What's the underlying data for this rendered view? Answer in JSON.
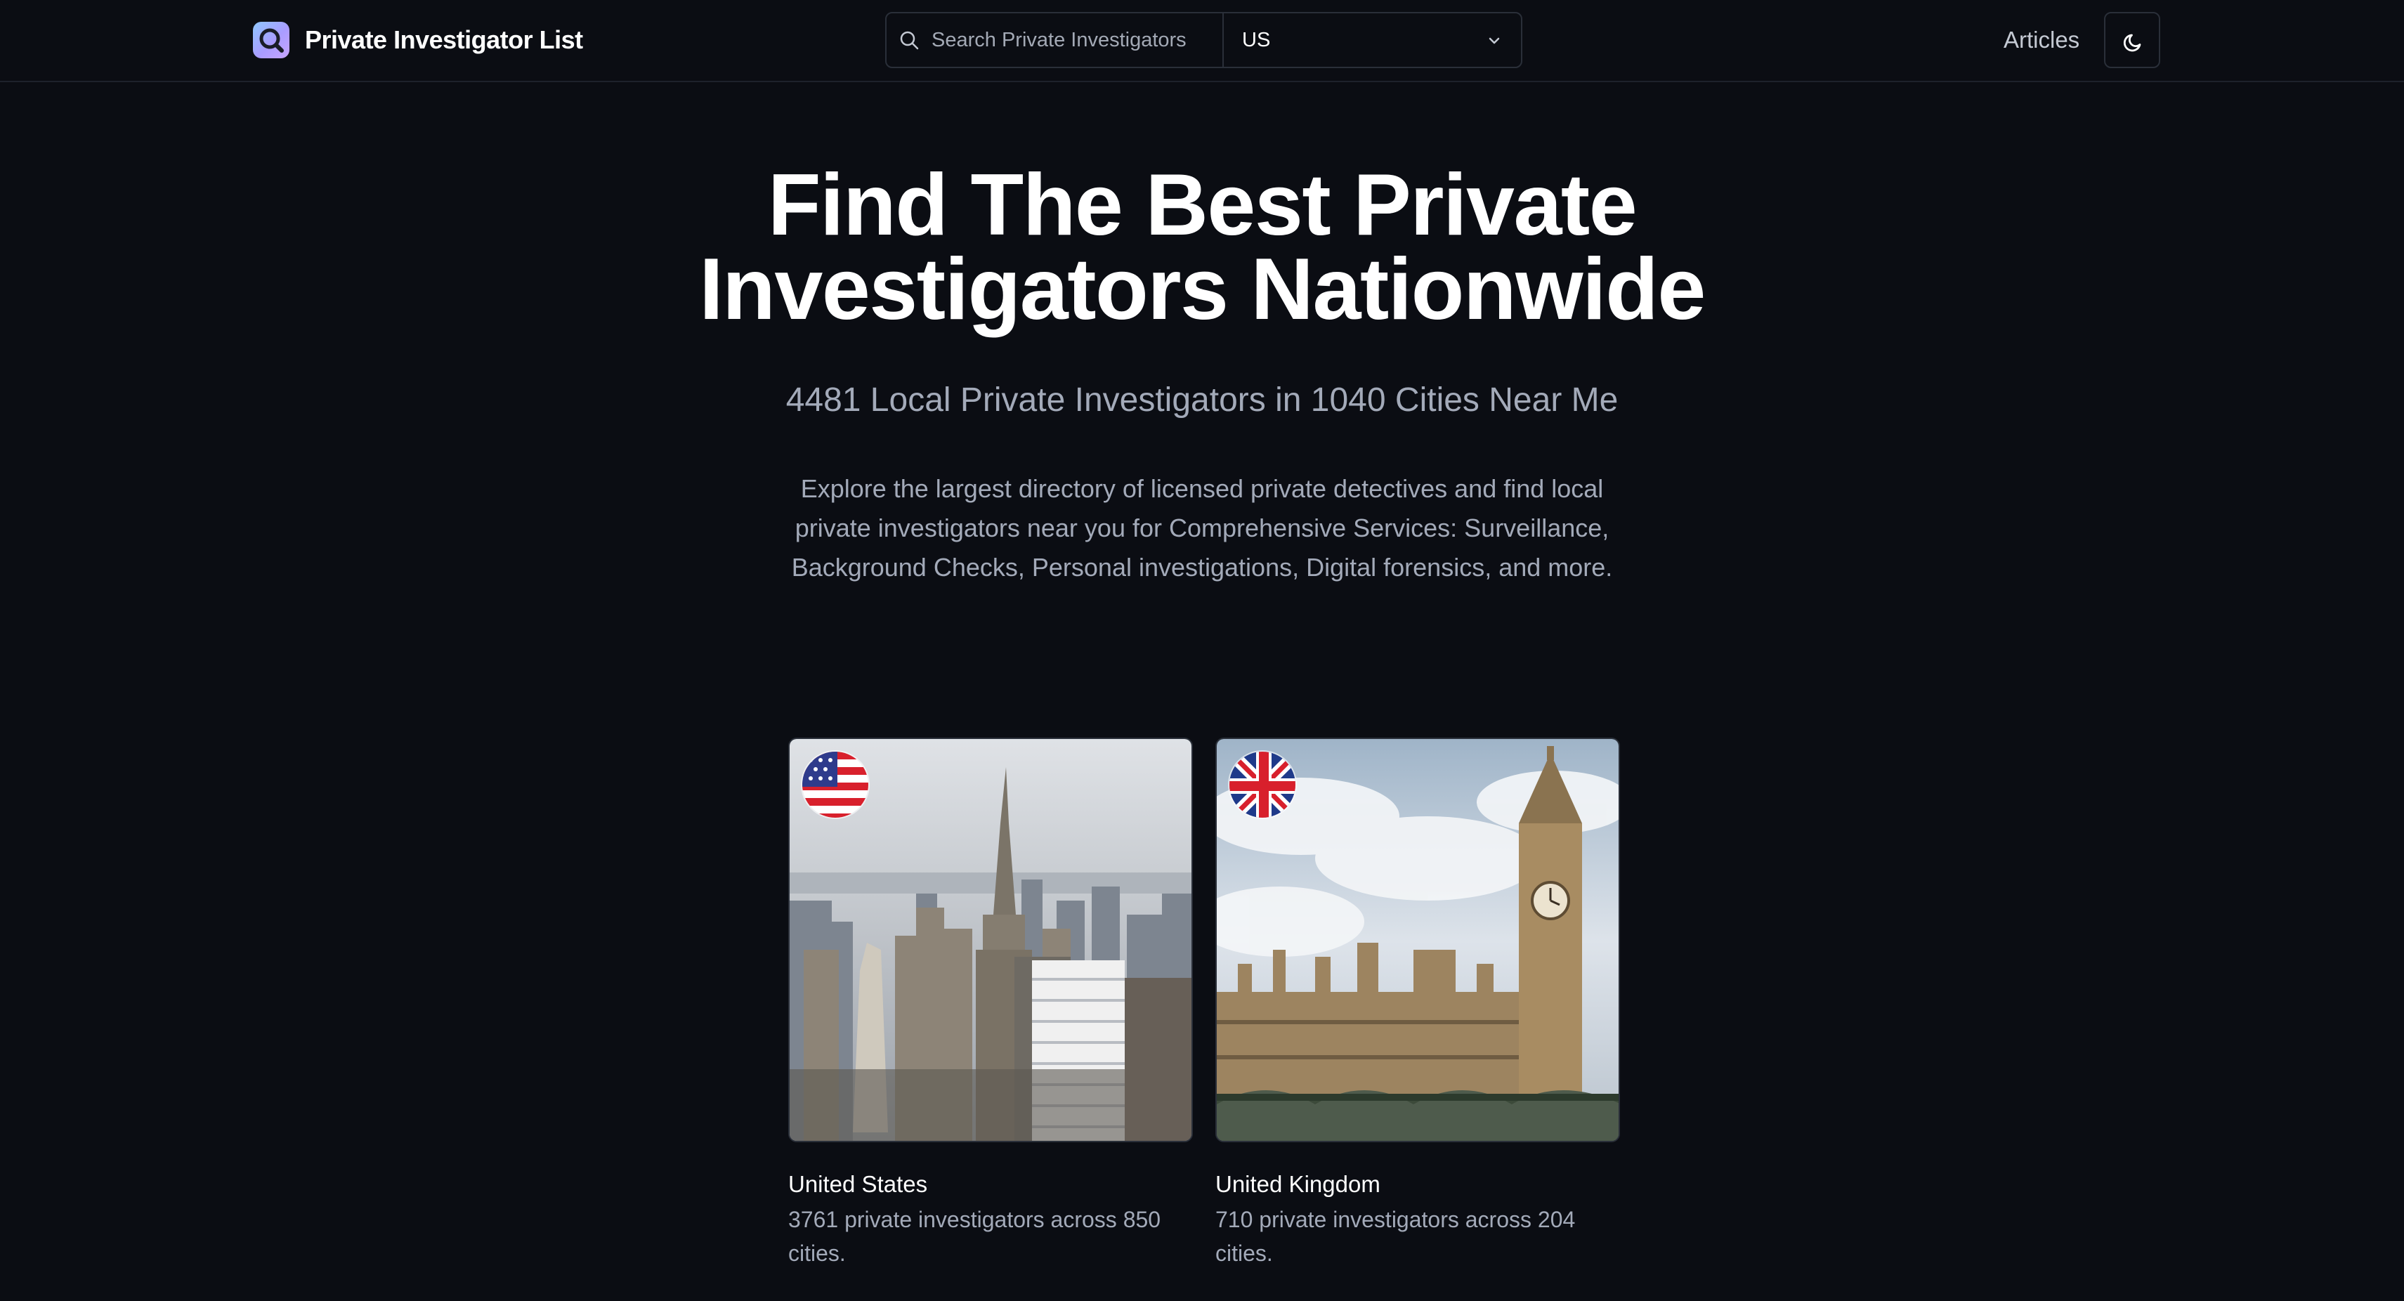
{
  "header": {
    "brand": "Private Investigator List",
    "search_placeholder": "Search Private Investigators",
    "country": "US",
    "articles_label": "Articles"
  },
  "hero": {
    "title_line1": "Find The Best Private",
    "title_line2": "Investigators Nationwide",
    "subtitle": "4481 Local Private Investigators in 1040 Cities Near Me",
    "desc_line1": "Explore the largest directory of licensed private detectives and find local",
    "desc_line2": "private investigators near you for Comprehensive Services: Surveillance,",
    "desc_line3": "Background Checks, Personal investigations, Digital forensics, and more."
  },
  "countries": [
    {
      "name": "United States",
      "line1": "3761 private investigators across 850",
      "line2": "cities."
    },
    {
      "name": "United Kingdom",
      "line1": "710 private investigators across 204",
      "line2": "cities."
    }
  ],
  "icons": {
    "logo": "magnifier-logo-icon",
    "search": "search-icon",
    "dropdown": "chevron-down-icon",
    "theme": "moon-icon"
  },
  "colors": {
    "background": "#0b0d13",
    "text": "#ffffff",
    "muted": "#a3aab9",
    "border": "#2a2f39"
  }
}
